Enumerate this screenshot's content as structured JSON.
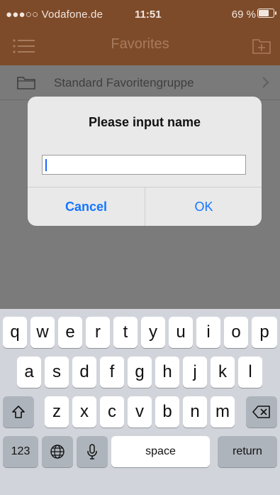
{
  "status_bar": {
    "carrier": "●●●○○ Vodafone.de",
    "time": "11:51",
    "battery_percent": "69 %"
  },
  "nav": {
    "title": "Favorites",
    "icons": [
      "menu-icon",
      "folder-add-icon"
    ]
  },
  "list": {
    "items": [
      {
        "label": "Standard Favoritengruppe",
        "icon": "folder-icon",
        "chevron": "chevron-right-icon"
      }
    ]
  },
  "dialog": {
    "title": "Please input name",
    "input_value": "",
    "cancel_label": "Cancel",
    "ok_label": "OK"
  },
  "keyboard": {
    "row1": [
      "q",
      "w",
      "e",
      "r",
      "t",
      "y",
      "u",
      "i",
      "o",
      "p"
    ],
    "row2": [
      "a",
      "s",
      "d",
      "f",
      "g",
      "h",
      "j",
      "k",
      "l"
    ],
    "row3": [
      "z",
      "x",
      "c",
      "v",
      "b",
      "n",
      "m"
    ],
    "bottom": {
      "numbers": "123",
      "space": "space",
      "return": "return"
    },
    "icons": [
      "shift-icon",
      "backspace-icon",
      "globe-icon",
      "microphone-icon"
    ]
  },
  "colors": {
    "nav_bg": "#7e4b2a",
    "accent": "#1675ff",
    "dimmed_bg": "#7a7a7a",
    "keyboard_bg": "#d1d5db"
  }
}
